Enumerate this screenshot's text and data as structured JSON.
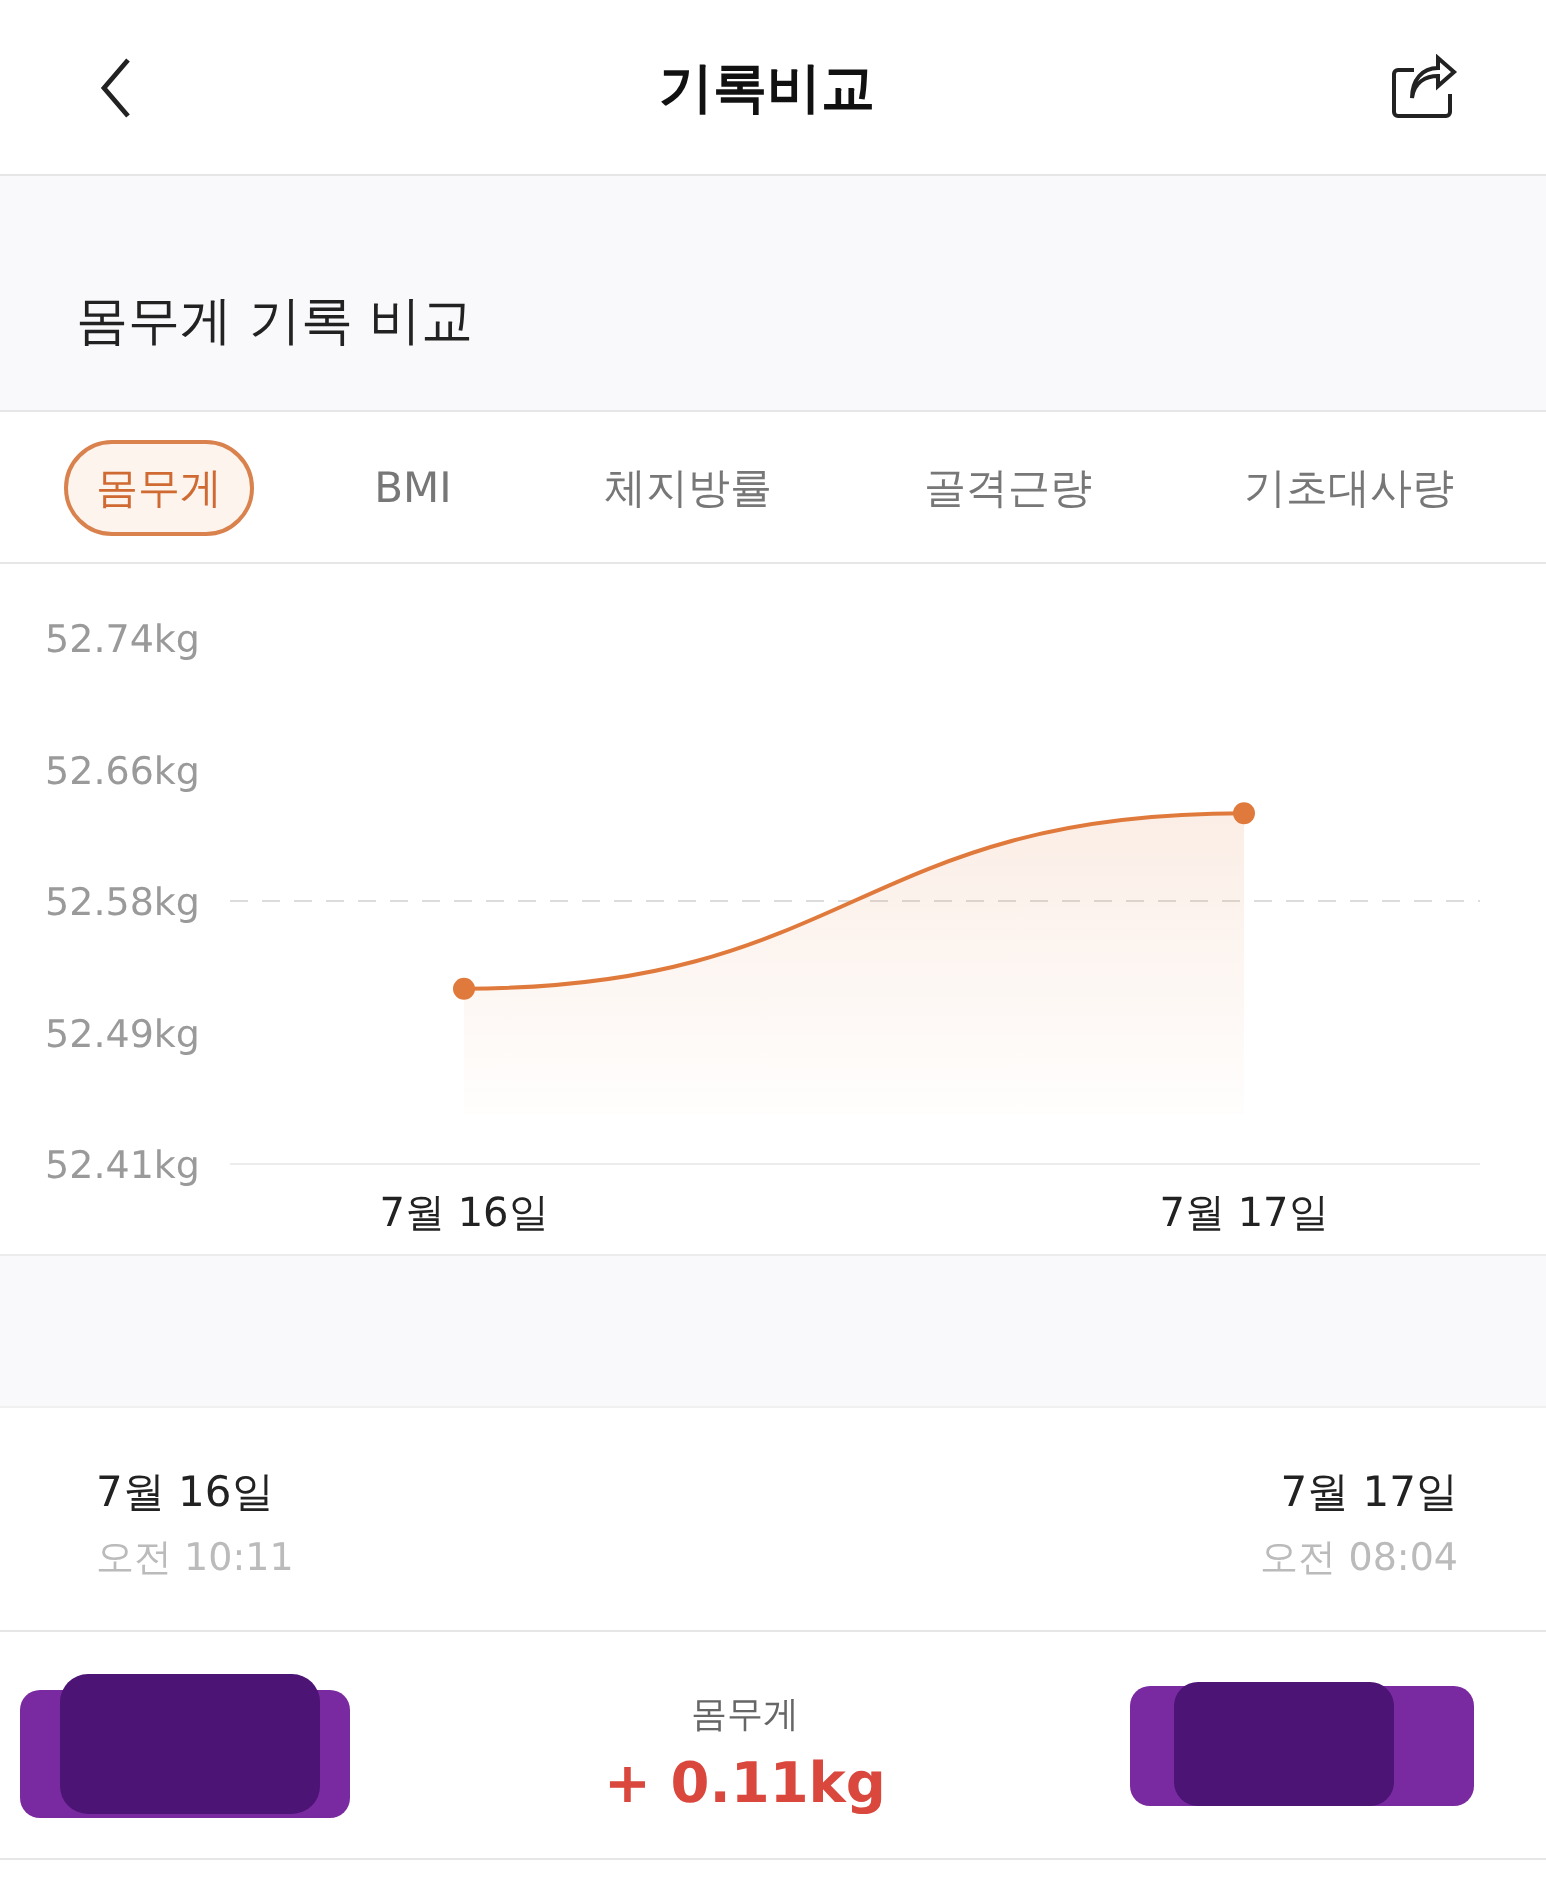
{
  "header": {
    "title": "기록비교"
  },
  "section": {
    "title": "몸무게 기록 비교"
  },
  "tabs": [
    {
      "label": "몸무게",
      "selected": true
    },
    {
      "label": "BMI",
      "selected": false
    },
    {
      "label": "체지방률",
      "selected": false
    },
    {
      "label": "골격근량",
      "selected": false
    },
    {
      "label": "기초대사량",
      "selected": false
    }
  ],
  "chart": {
    "chart_data": {
      "type": "area",
      "categories": [
        "7월 16일",
        "7월 17일"
      ],
      "series": [
        {
          "color": "#e07a3c",
          "values": [
            52.52,
            52.63
          ]
        }
      ],
      "ylim": [
        52.41,
        52.74
      ],
      "yticks": [
        {
          "value": 52.74,
          "label": "52.74kg"
        },
        {
          "value": 52.6575,
          "label": "52.66kg"
        },
        {
          "value": 52.575,
          "label": "52.58kg"
        },
        {
          "value": 52.4925,
          "label": "52.49kg"
        },
        {
          "value": 52.41,
          "label": "52.41kg"
        }
      ]
    }
  },
  "compare": {
    "from": {
      "date": "7월 16일",
      "time": "오전 10:11"
    },
    "to": {
      "date": "7월 17일",
      "time": "오전 08:04"
    }
  },
  "result": {
    "label": "몸무게",
    "change": "+ 0.11kg"
  }
}
